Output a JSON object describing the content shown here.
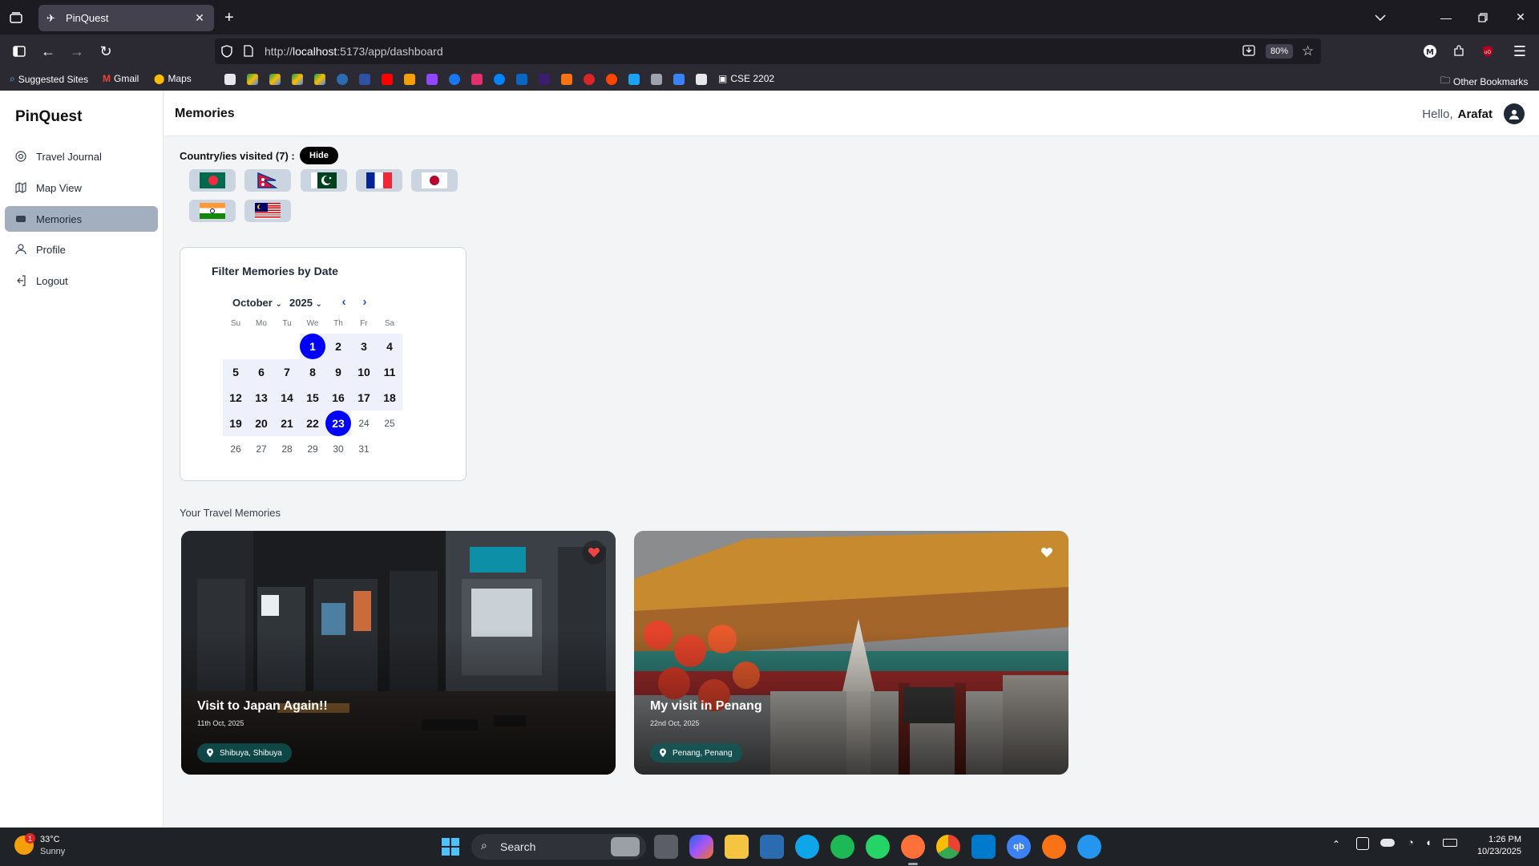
{
  "browser": {
    "tab_title": "PinQuest",
    "url_prefix": "http://",
    "url_host": "localhost",
    "url_rest": ":5173/app/dashboard",
    "zoom": "80%",
    "bookmarks": {
      "suggested": "Suggested Sites",
      "gmail": "Gmail",
      "maps": "Maps",
      "cse": "CSE 2202",
      "other": "Other Bookmarks"
    }
  },
  "app": {
    "brand": "PinQuest",
    "page_title": "Memories",
    "greeting": "Hello,",
    "user_name": "Arafat",
    "menu": [
      {
        "label": "Travel Journal",
        "icon": "globe-icon"
      },
      {
        "label": "Map View",
        "icon": "map-icon"
      },
      {
        "label": "Memories",
        "icon": "memories-icon",
        "active": true
      },
      {
        "label": "Profile",
        "icon": "user-icon"
      },
      {
        "label": "Logout",
        "icon": "logout-icon"
      }
    ]
  },
  "countries": {
    "label": "Country/ies visited (7) :",
    "hide_label": "Hide",
    "flags": [
      "bangladesh",
      "nepal",
      "pakistan",
      "france",
      "japan",
      "india",
      "malaysia"
    ]
  },
  "calendar": {
    "title": "Filter Memories by Date",
    "month": "October",
    "year": "2025",
    "weekdays": [
      "Su",
      "Mo",
      "Tu",
      "We",
      "Th",
      "Fr",
      "Sa"
    ],
    "rows": [
      [
        "",
        "",
        "",
        "1",
        "2",
        "3",
        "4"
      ],
      [
        "5",
        "6",
        "7",
        "8",
        "9",
        "10",
        "11"
      ],
      [
        "12",
        "13",
        "14",
        "15",
        "16",
        "17",
        "18"
      ],
      [
        "19",
        "20",
        "21",
        "22",
        "23",
        "24",
        "25"
      ],
      [
        "26",
        "27",
        "28",
        "29",
        "30",
        "31",
        ""
      ]
    ],
    "range_start": "1",
    "range_end": "23"
  },
  "memories": {
    "label": "Your Travel Memories",
    "cards": [
      {
        "title": "Visit to Japan Again!!",
        "date": "11th Oct, 2025",
        "location": "Shibuya, Shibuya",
        "favorite": true
      },
      {
        "title": "My visit in Penang",
        "date": "22nd Oct, 2025",
        "location": "Penang, Penang",
        "favorite": false
      }
    ]
  },
  "taskbar": {
    "temperature": "33°C",
    "weather": "Sunny",
    "search_label": "Search",
    "time": "1:26 PM",
    "date": "10/23/2025",
    "weather_badge": "1"
  },
  "colors": {
    "accent_blue": "#0000ff",
    "active_menu": "#a3aebf",
    "heart_red": "#ef4444"
  }
}
